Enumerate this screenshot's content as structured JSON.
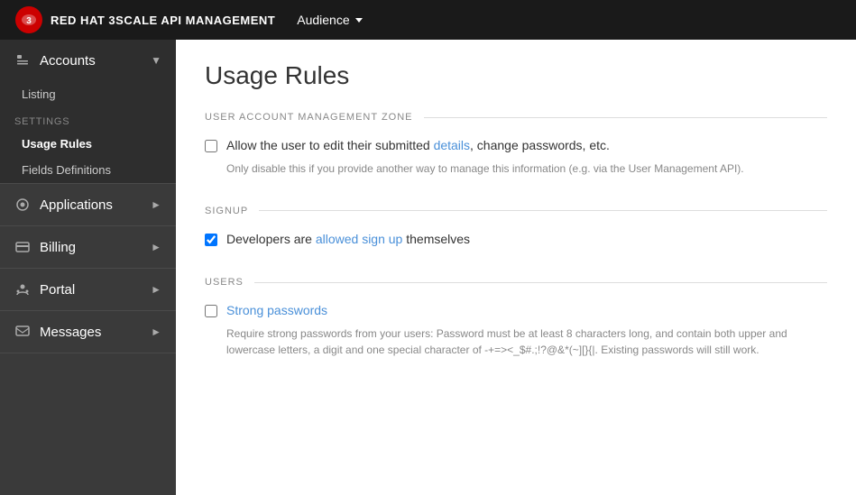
{
  "topnav": {
    "brand": "RED HAT 3SCALE API MANAGEMENT",
    "audience_label": "Audience"
  },
  "sidebar": {
    "accounts": {
      "label": "Accounts",
      "sub": {
        "listing_label": "Listing",
        "settings_label": "Settings",
        "usage_rules_label": "Usage Rules",
        "fields_definitions_label": "Fields Definitions"
      }
    },
    "applications": {
      "label": "Applications"
    },
    "billing": {
      "label": "Billing"
    },
    "portal": {
      "label": "Portal"
    },
    "messages": {
      "label": "Messages"
    }
  },
  "content": {
    "page_title": "Usage Rules",
    "section1": {
      "label": "USER ACCOUNT MANAGEMENT ZONE",
      "checkbox1_label": "Allow the user to edit their submitted details, change passwords, etc.",
      "checkbox1_hint": "Only disable this if you provide another way to manage this information (e.g. via the User Management API).",
      "checkbox1_checked": false
    },
    "section2": {
      "label": "SIGNUP",
      "checkbox2_label": "Developers are allowed sign up themselves",
      "checkbox2_checked": true
    },
    "section3": {
      "label": "USERS",
      "checkbox3_label": "Strong passwords",
      "checkbox3_hint": "Require strong passwords from your users: Password must be at least 8 characters long, and contain both upper and lowercase letters, a digit and one special character of -+=><_$#.;!?@&*(~][}{|. Existing passwords will still work.",
      "checkbox3_checked": false
    }
  }
}
